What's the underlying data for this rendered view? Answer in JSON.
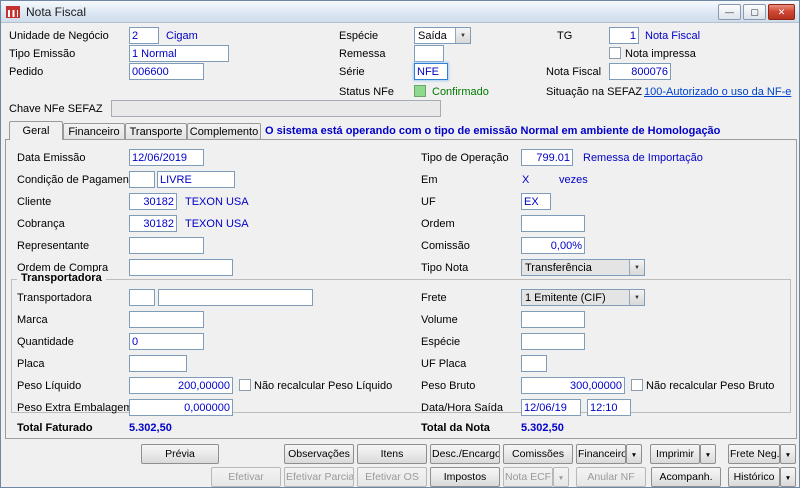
{
  "colors": {
    "value_text": "#0000C8",
    "status_ok": "#007A00",
    "link": "#0044CC",
    "message": "#0000C8"
  },
  "icons": {
    "dropdown": "▼",
    "minimize": "—",
    "maximize": "▢",
    "close": "✕"
  },
  "window": {
    "title": "Nota Fiscal"
  },
  "header": {
    "unidade_label": "Unidade de Negócio",
    "unidade_value": "2",
    "unidade_suffix": "Cigam",
    "tipo_emissao_label": "Tipo Emissão",
    "tipo_emissao_value": "1 Normal",
    "pedido_label": "Pedido",
    "pedido_value": "006600",
    "especie_label": "Espécie",
    "especie_value": "Saída",
    "remessa_label": "Remessa",
    "remessa_value": "",
    "serie_label": "Série",
    "serie_value": "NFE",
    "status_label": "Status NFe",
    "status_value": "Confirmado",
    "tg_label": "TG",
    "tg_value": "1",
    "tg_suffix": "Nota Fiscal",
    "nota_impressa_label": "Nota impressa",
    "nota_fiscal_label": "Nota Fiscal",
    "nota_fiscal_value": "800076",
    "sefaz_label": "Situação na SEFAZ",
    "sefaz_link": "100-Autorizado o uso da NF-e",
    "chave_label": "Chave NFe SEFAZ",
    "chave_value": ""
  },
  "tabs": {
    "geral": "Geral",
    "financeiro": "Financeiro",
    "transporte": "Transporte",
    "complemento": "Complemento",
    "message": "O sistema está operando com o tipo de emissão Normal em ambiente de Homologação"
  },
  "geral": {
    "data_emissao_label": "Data Emissão",
    "data_emissao_value": "12/06/2019",
    "cond_pag_label": "Condição de Pagamento",
    "cond_pag_code": "",
    "cond_pag_value": "LIVRE",
    "cliente_label": "Cliente",
    "cliente_code": "30182",
    "cliente_name": "TEXON USA",
    "cobranca_label": "Cobrança",
    "cobranca_code": "30182",
    "cobranca_name": "TEXON USA",
    "representante_label": "Representante",
    "representante_value": "",
    "ordem_compra_label": "Ordem de Compra",
    "ordem_compra_value": "",
    "tipo_operacao_label": "Tipo de Operação",
    "tipo_operacao_code": "799.01",
    "tipo_operacao_name": "Remessa de Importação",
    "em_label": "Em",
    "em_value": "X",
    "em_suffix": "vezes",
    "uf_label": "UF",
    "uf_value": "EX",
    "ordem_label": "Ordem",
    "ordem_value": "",
    "comissao_label": "Comissão",
    "comissao_value": "0,00%",
    "tipo_nota_label": "Tipo Nota",
    "tipo_nota_value": "Transferência"
  },
  "transportadora": {
    "title": "Transportadora",
    "transportadora_label": "Transportadora",
    "transportadora_code": "",
    "transportadora_name": "",
    "marca_label": "Marca",
    "marca_value": "",
    "quantidade_label": "Quantidade",
    "quantidade_value": "0",
    "placa_label": "Placa",
    "placa_value": "",
    "peso_liquido_label": "Peso Líquido",
    "peso_liquido_value": "200,00000",
    "nao_recalc_liquido_label": "Não recalcular Peso Líquido",
    "peso_extra_label": "Peso Extra Embalagem",
    "peso_extra_value": "0,000000",
    "frete_label": "Frete",
    "frete_value": "1 Emitente (CIF)",
    "volume_label": "Volume",
    "volume_value": "",
    "especie_label": "Espécie",
    "especie_value": "",
    "uf_placa_label": "UF Placa",
    "uf_placa_value": "",
    "peso_bruto_label": "Peso Bruto",
    "peso_bruto_value": "300,00000",
    "nao_recalc_bruto_label": "Não recalcular Peso Bruto",
    "data_saida_label": "Data/Hora Saída",
    "data_saida_value": "12/06/19",
    "hora_saida_value": "12:10"
  },
  "totais": {
    "faturado_label": "Total Faturado",
    "faturado_value": "5.302,50",
    "nota_label": "Total da Nota",
    "nota_value": "5.302,50"
  },
  "buttons": {
    "previa": "Prévia",
    "observacoes": "Observações",
    "itens": "Itens",
    "desc_encargos": "Desc./Encargos",
    "comissoes": "Comissões",
    "financeiro": "Financeiro",
    "imprimir": "Imprimir",
    "frete_neg": "Frete Neg.",
    "efetivar": "Efetivar",
    "efetivar_parcial": "Efetivar Parcial",
    "efetivar_os": "Efetivar OS",
    "impostos": "Impostos",
    "nota_ecf": "Nota ECF",
    "anular_nf": "Anular NF",
    "acompanh": "Acompanh.",
    "historico": "Histórico"
  }
}
